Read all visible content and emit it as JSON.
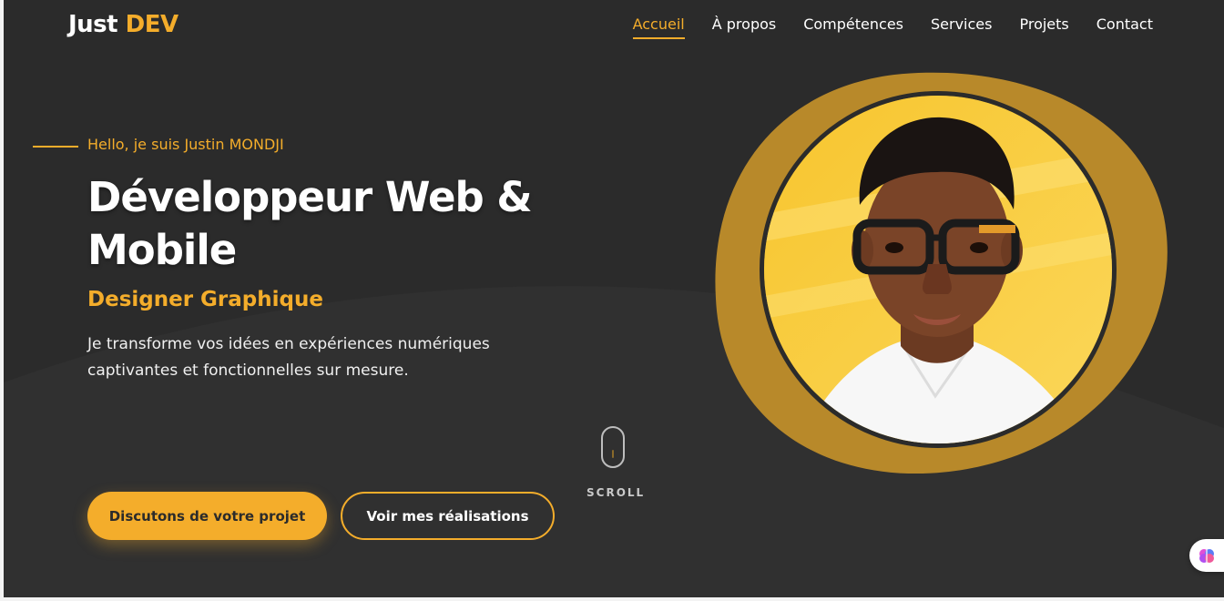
{
  "header": {
    "logo_main": "Just",
    "logo_accent": "DEV",
    "nav": [
      {
        "label": "Accueil",
        "active": true
      },
      {
        "label": "À propos",
        "active": false
      },
      {
        "label": "Compétences",
        "active": false
      },
      {
        "label": "Services",
        "active": false
      },
      {
        "label": "Projets",
        "active": false
      },
      {
        "label": "Contact",
        "active": false
      }
    ]
  },
  "hero": {
    "greeting": "Hello, je suis Justin MONDJI",
    "title_line1": "Développeur Web &",
    "title_line2": "Mobile",
    "subtitle": "Designer Graphique",
    "description_line1": "Je transforme vos idées en expériences numériques",
    "description_line2": "captivantes et fonctionnelles sur mesure.",
    "primary_button": "Discutons de votre projet",
    "secondary_button": "Voir mes réalisations",
    "scroll_label": "SCROLL"
  },
  "colors": {
    "accent": "#f4ad2b",
    "background": "#2b2b2b",
    "blob": "#b8892a"
  },
  "icons": {
    "scroll": "mouse-scroll-icon",
    "assistant": "brain-icon"
  }
}
